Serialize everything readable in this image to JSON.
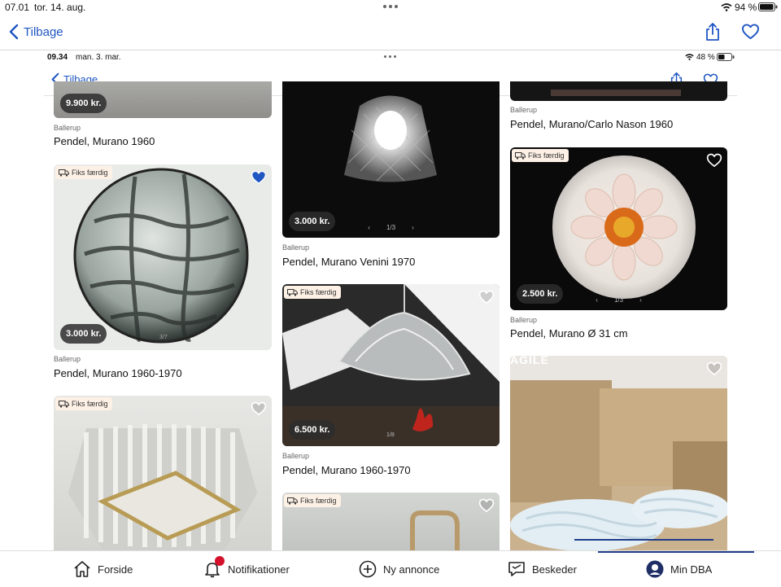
{
  "outer_status": {
    "time": "07.01",
    "date": "tor. 14. aug.",
    "battery": "94 %"
  },
  "outer_nav": {
    "back_label": "Tilbage"
  },
  "inner_status": {
    "time": "09.34",
    "date": "man. 3. mar.",
    "battery": "48 %"
  },
  "inner_nav": {
    "back_label": "Tilbage"
  },
  "listings": [
    {
      "price": "9.900 kr.",
      "location": "Ballerup",
      "title": "Pendel, Murano 1960"
    },
    {
      "price": "3.000 kr.",
      "badge": "Fiks færdig",
      "location": "Ballerup",
      "title": "Pendel, Murano 1960-1970",
      "pager": "3/7"
    },
    {
      "badge": "Fiks færdig"
    },
    {
      "price": "3.000 kr.",
      "location": "Ballerup",
      "title": "Pendel, Murano Venini 1970",
      "pager": "1/3"
    },
    {
      "price": "6.500 kr.",
      "badge": "Fiks færdig",
      "location": "Ballerup",
      "title": "Pendel, Murano 1960-1970",
      "pager": "1/8"
    },
    {
      "badge": "Fiks færdig"
    },
    {
      "location": "Ballerup",
      "title": "Pendel, Murano/Carlo Nason 1960"
    },
    {
      "price": "2.500 kr.",
      "badge": "Fiks færdig",
      "location": "Ballerup",
      "title": "Pendel, Murano Ø 31 cm",
      "pager": "1/3"
    },
    {
      "sign_text": "AGILE"
    }
  ],
  "tabbar": {
    "home": "Forside",
    "notifications": "Notifikationer",
    "new_ad": "Ny annonce",
    "messages": "Beskeder",
    "my_dba": "Min DBA"
  },
  "colors": {
    "accent": "#1f56c2",
    "badge_bg": "#fdf1e6",
    "notification_red": "#d4102a",
    "fav_active": "#1f56c2"
  }
}
